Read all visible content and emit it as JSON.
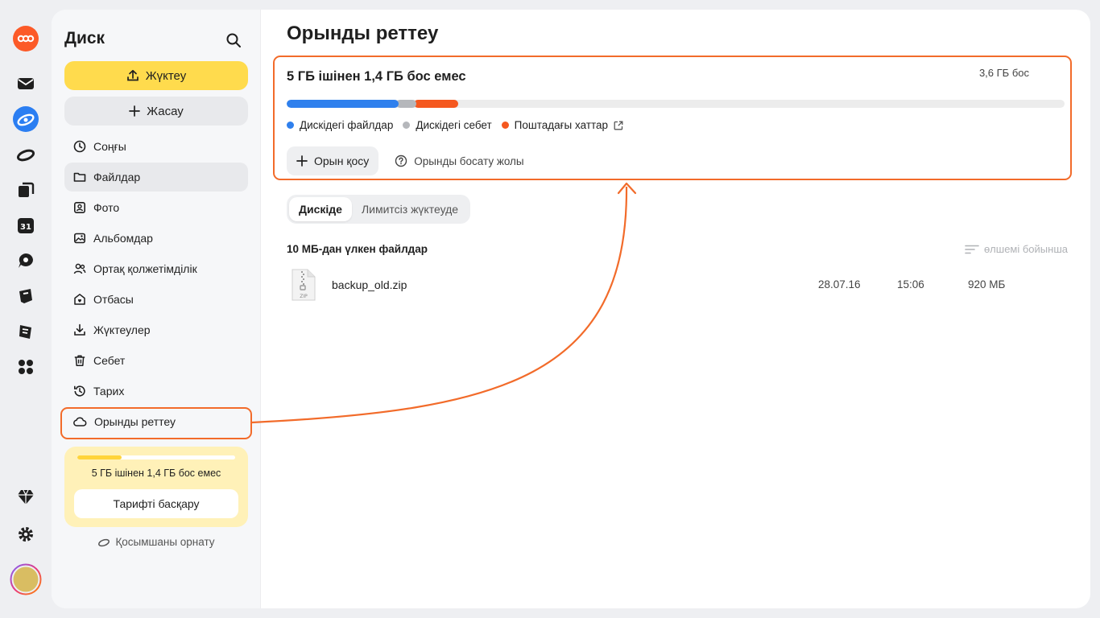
{
  "sidebar": {
    "title": "Диск",
    "upload_label": "Жүктеу",
    "create_label": "Жасау",
    "items": [
      {
        "label": "Соңғы",
        "icon": "clock-icon"
      },
      {
        "label": "Файлдар",
        "icon": "folder-icon"
      },
      {
        "label": "Фото",
        "icon": "photo-icon"
      },
      {
        "label": "Альбомдар",
        "icon": "album-icon"
      },
      {
        "label": "Ортақ қолжетімділік",
        "icon": "shared-icon"
      },
      {
        "label": "Отбасы",
        "icon": "family-icon"
      },
      {
        "label": "Жүктеулер",
        "icon": "download-icon"
      },
      {
        "label": "Себет",
        "icon": "trash-icon"
      },
      {
        "label": "Тарих",
        "icon": "history-icon"
      },
      {
        "label": "Орынды реттеу",
        "icon": "cloud-icon"
      }
    ],
    "active_item": "Файлдар",
    "quota": {
      "text": "5 ГБ  ішінен 1,4 ГБ бос емес",
      "used_fraction": 0.28,
      "manage_label": "Тарифті  басқару"
    },
    "install_label": "Қосымшаны орнату"
  },
  "main": {
    "title": "Орынды реттеу",
    "storage": {
      "headline": "5 ГБ ішінен 1,4 ГБ бос емес",
      "free_label": "3,6 ГБ бос",
      "segments": [
        {
          "label": "Дискідегі файлдар",
          "color": "#2f80ed",
          "fraction": 0.141
        },
        {
          "label": "Дискідегі себет",
          "color": "#b5b7bb",
          "fraction": 0.023
        },
        {
          "label": "Поштадағы хаттар",
          "color": "#f5581f",
          "fraction": 0.054
        }
      ],
      "add_space_label": "Орын қосу",
      "help_label": "Орынды босату жолы"
    },
    "tabs": [
      {
        "label": "Дискіде",
        "selected": true
      },
      {
        "label": "Лимитсіз жүктеуде",
        "selected": false
      }
    ],
    "list_title": "10 МБ-дан үлкен файлдар",
    "sort_label": "өлшемі бойынша",
    "files": [
      {
        "name": "backup_old.zip",
        "date": "28.07.16",
        "time": "15:06",
        "size": "920 МБ",
        "icon_text": "ZIP"
      }
    ]
  },
  "colors": {
    "accent": "#ffdb4d",
    "annotation": "#f26b2a",
    "mail": "#f5581f",
    "files": "#2f80ed"
  }
}
